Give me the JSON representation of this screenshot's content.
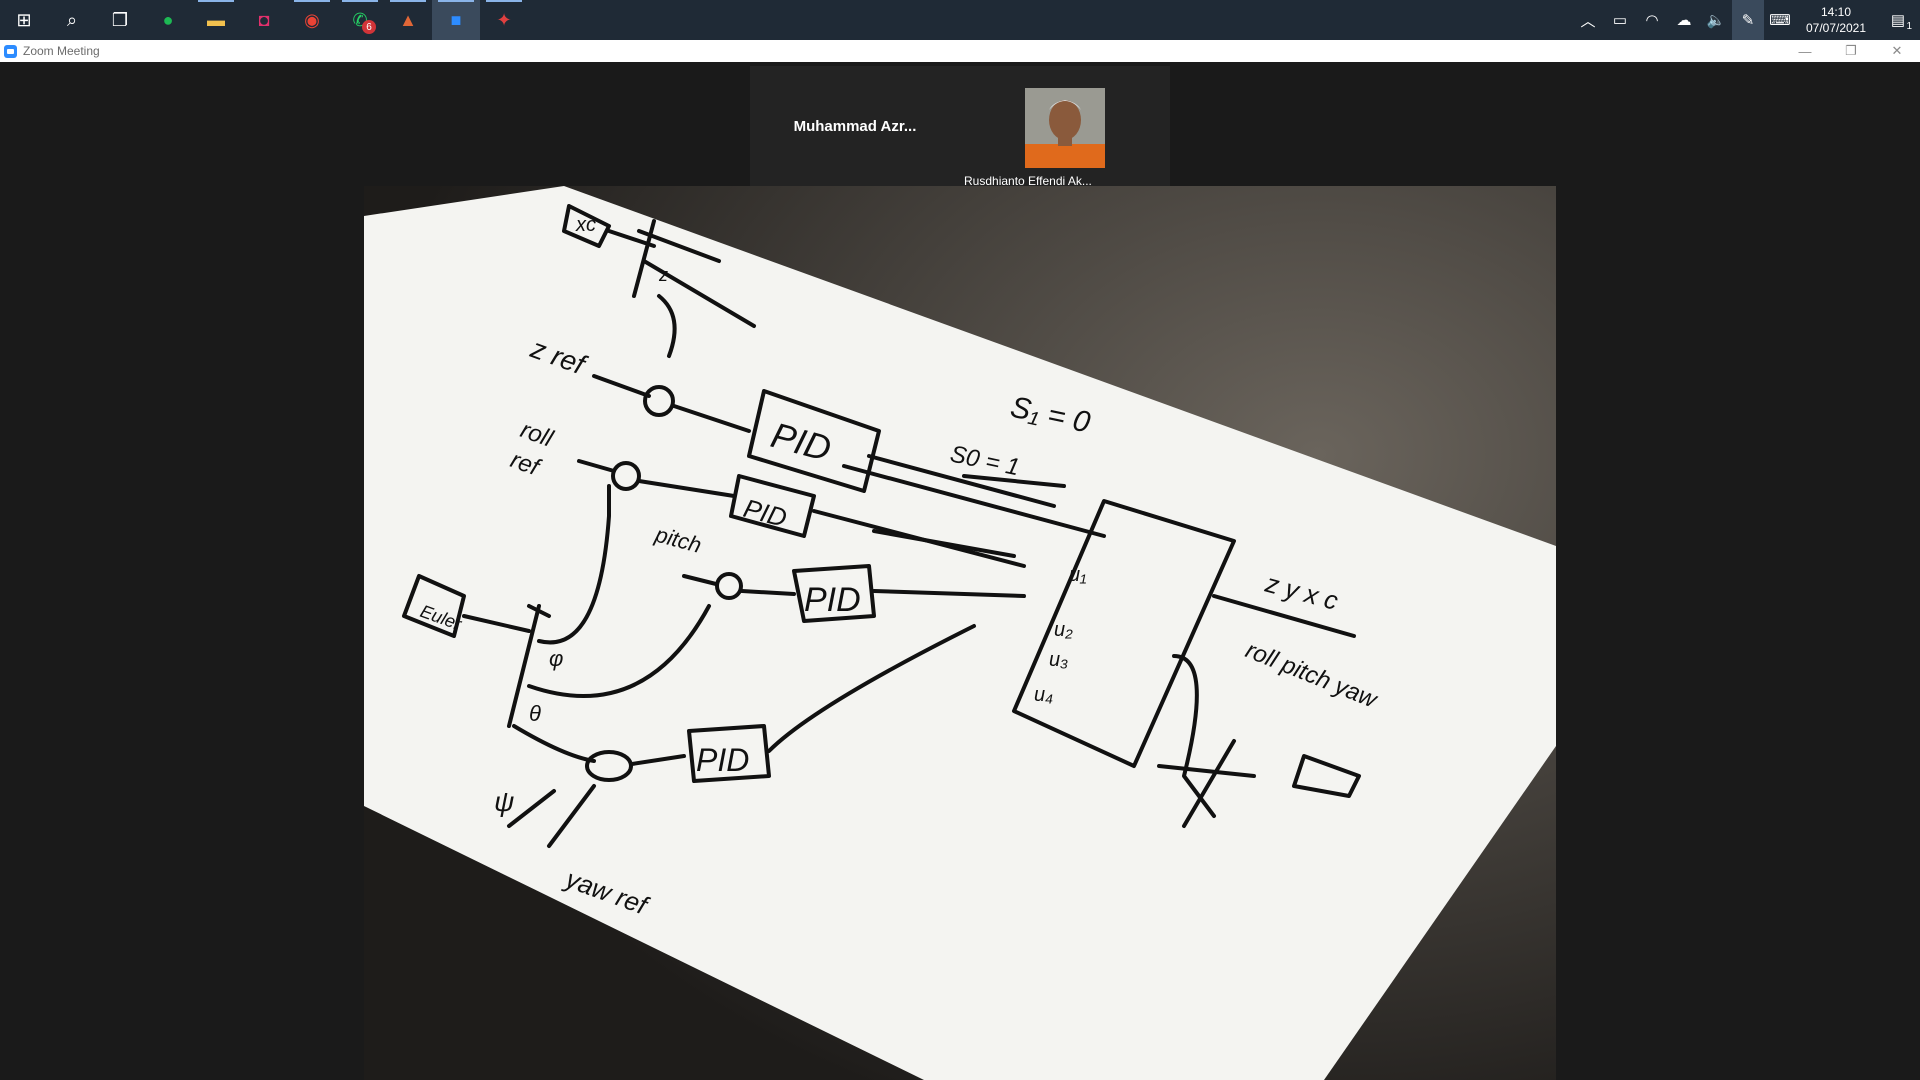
{
  "taskbar": {
    "apps": [
      {
        "name": "start",
        "glyph": "⊞"
      },
      {
        "name": "search",
        "glyph": "⌕"
      },
      {
        "name": "task-view",
        "glyph": "❐"
      },
      {
        "name": "spotify",
        "glyph": "●"
      },
      {
        "name": "file-explorer",
        "glyph": "▬"
      },
      {
        "name": "instagram",
        "glyph": "◘"
      },
      {
        "name": "chrome",
        "glyph": "◉"
      },
      {
        "name": "whatsapp",
        "glyph": "✆",
        "badge": "6"
      },
      {
        "name": "matlab",
        "glyph": "▲"
      },
      {
        "name": "zoom",
        "glyph": "■"
      },
      {
        "name": "app",
        "glyph": "✦"
      }
    ],
    "clock": {
      "time": "14:10",
      "date": "07/07/2021"
    },
    "notification_badge": "1"
  },
  "window": {
    "title": "Zoom Meeting"
  },
  "participants": [
    {
      "name": "Muhammad  Azr..."
    },
    {
      "name": "Rusdhianto Effendi Ak..."
    }
  ],
  "sketch": {
    "labels": {
      "xc": "xс",
      "z": "z",
      "zref": "z ref",
      "roll": "roll",
      "ref": "ref",
      "pitch": "pitch",
      "roll_pitch_yaw": "roll pitch yaw",
      "s1": "S₁ = 0",
      "s0": "S0 = 1",
      "u1": "u₁",
      "u2": "u₂",
      "u3": "u₃",
      "u4": "u₄",
      "zyx": "z y x c",
      "yaw_ref": "yaw ref",
      "pid": "PID",
      "phi": "φ",
      "theta": "θ",
      "psi": "ψ",
      "euler": "Euler"
    }
  },
  "colors": {
    "taskbar": "#1f2a36",
    "zoom_blue": "#2d8cff",
    "meeting_bg": "#1a1a1a"
  }
}
